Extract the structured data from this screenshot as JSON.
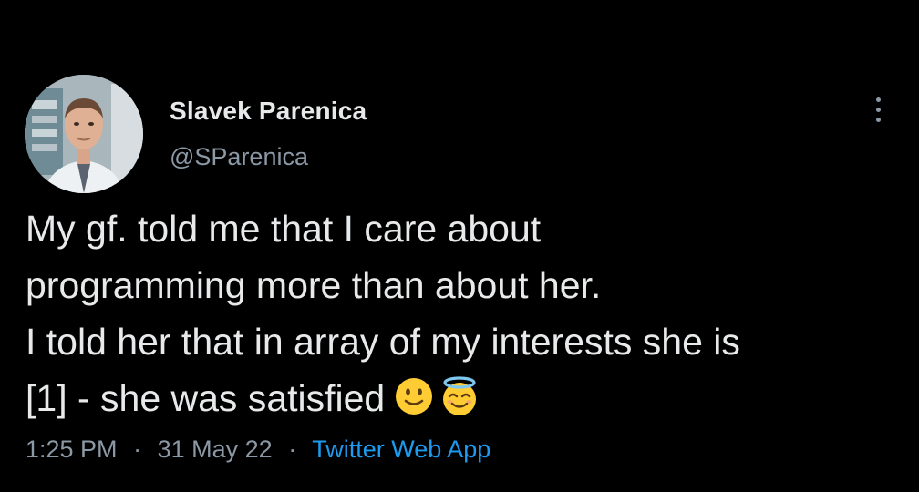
{
  "author": {
    "display_name": "Slavek Parenica",
    "handle": "@SParenica",
    "avatar_icon": "profile-photo"
  },
  "more_menu_icon": "vertical-ellipsis-icon",
  "tweet": {
    "lines": [
      "My gf. told me that I care about",
      "programming more than about her.",
      "I told her that in array of my interests she is",
      "[1] - she was satisfied"
    ],
    "emojis": [
      "slightly-smiling-face",
      "smiling-face-with-halo"
    ]
  },
  "meta": {
    "time": "1:25 PM",
    "separator": "·",
    "date": "31 May 22",
    "source": "Twitter Web App"
  },
  "colors": {
    "background": "#000000",
    "primary_text": "#e7e9ea",
    "secondary_text": "#8b98a5",
    "link": "#1d9bf0"
  }
}
